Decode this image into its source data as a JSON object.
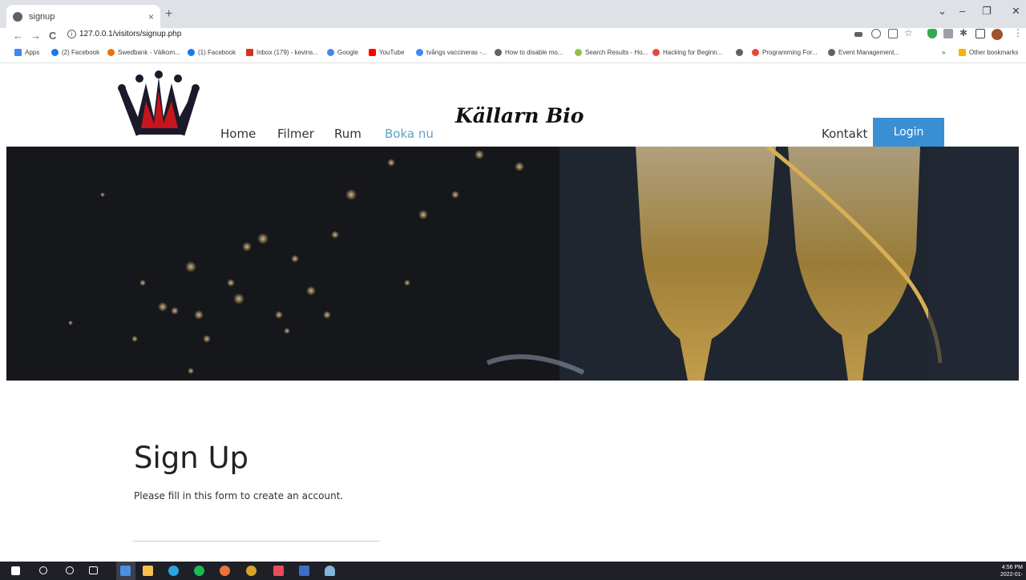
{
  "browser": {
    "tab_title": "signup",
    "tab_close": "×",
    "new_tab": "+",
    "url": "127.0.0.1/visitors/signup.php",
    "nav": {
      "back": "←",
      "forward": "→",
      "reload": "C"
    },
    "window_controls": {
      "dropdown": "⌄",
      "minimize": "–",
      "restore": "❐",
      "close": "✕"
    },
    "bookmarks": [
      {
        "label": "Apps",
        "color": "#4285f4"
      },
      {
        "label": "(2) Facebook",
        "color": "#1877f2"
      },
      {
        "label": "Swedbank - Välkom...",
        "color": "#ee7203"
      },
      {
        "label": "(1) Facebook",
        "color": "#1877f2"
      },
      {
        "label": "Inbox (179) - kevins...",
        "color": "#d93025"
      },
      {
        "label": "Google",
        "color": "#4285f4"
      },
      {
        "label": "YouTube",
        "color": "#ff0000"
      },
      {
        "label": "tvångs vaccineras -...",
        "color": "#4285f4"
      },
      {
        "label": "How to disable mo...",
        "color": "#5f6368"
      },
      {
        "label": "Search Results - Ho...",
        "color": "#8bc34a"
      },
      {
        "label": "Hacking for Beginn...",
        "color": "#e8453c"
      },
      {
        "label": "",
        "color": "#5f6368"
      },
      {
        "label": "Programming For...",
        "color": "#e8453c"
      },
      {
        "label": "Event Management...",
        "color": "#5f6368"
      }
    ],
    "bookmarks_more": "»",
    "other_bookmarks": "Other bookmarks"
  },
  "site": {
    "brand": "Källarn Bio",
    "nav": {
      "home": "Home",
      "filmer": "Filmer",
      "rum": "Rum",
      "boka": "Boka nu",
      "kontakt": "Kontakt",
      "login": "Login"
    },
    "colors": {
      "accent": "#3a8fd4",
      "active_link": "#5fa3c7"
    }
  },
  "form": {
    "title": "Sign Up",
    "subtitle": "Please fill in this form to create an account."
  },
  "taskbar": {
    "time": "4:56 PM",
    "date": "2022-01-"
  }
}
